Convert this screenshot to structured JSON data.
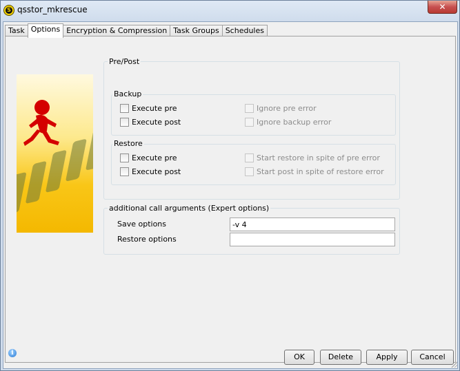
{
  "window": {
    "title": "qsstor_mkrescue",
    "close_glyph": "✕"
  },
  "tabs": [
    "Task",
    "Options",
    "Encryption & Compression",
    "Task Groups",
    "Schedules"
  ],
  "active_tab": "Options",
  "prepost": {
    "legend": "Pre/Post",
    "backup": {
      "legend": "Backup",
      "execute_pre": "Execute pre",
      "execute_post": "Execute post",
      "ignore_pre_error": "Ignore pre error",
      "ignore_backup_error": "Ignore backup error"
    },
    "restore": {
      "legend": "Restore",
      "execute_pre": "Execute pre",
      "execute_post": "Execute post",
      "start_restore_in_spite": "Start restore in spite of pre error",
      "start_post_in_spite": "Start post in spite of restore error"
    }
  },
  "expert": {
    "legend": "additional call arguments (Expert options)",
    "save_label": "Save options",
    "save_value": "-v 4",
    "restore_label": "Restore options",
    "restore_value": ""
  },
  "buttons": {
    "ok": "OK",
    "delete": "Delete",
    "apply": "Apply",
    "cancel": "Cancel"
  },
  "icons": {
    "app": "qsstor-logo-icon",
    "info": "info-icon",
    "close": "close-icon",
    "resize": "resize-grip-icon"
  },
  "colors": {
    "accent_yellow": "#f4b800",
    "runner_red": "#d40000"
  }
}
